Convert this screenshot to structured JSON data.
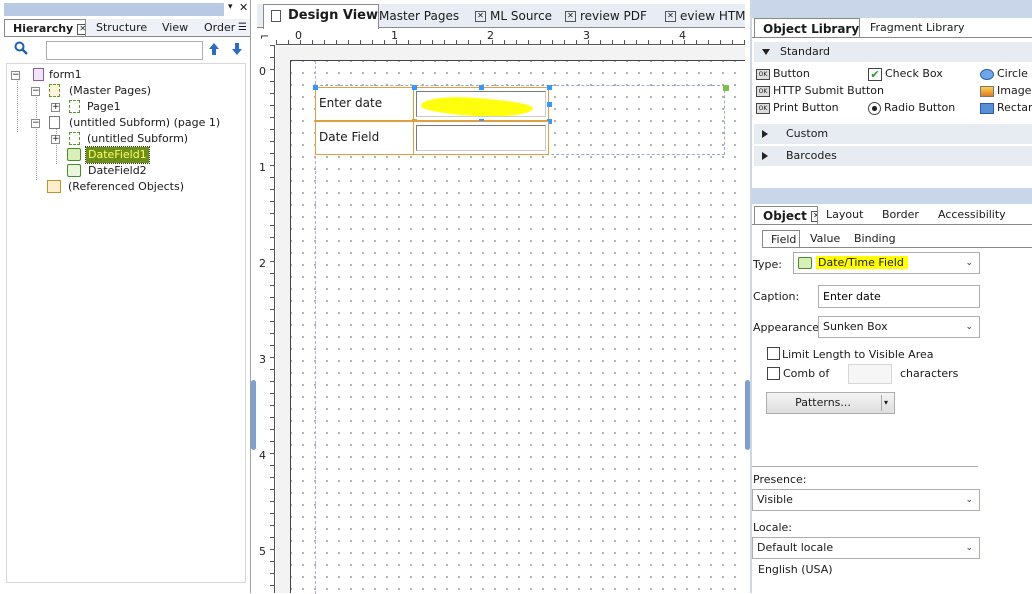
{
  "hierarchy": {
    "tabs": [
      "Hierarchy",
      "Structure",
      "View",
      "Order"
    ],
    "tree": [
      {
        "label": "form1"
      },
      {
        "label": "(Master Pages)"
      },
      {
        "label": "Page1"
      },
      {
        "label": "(untitled Subform) (page 1)"
      },
      {
        "label": "(untitled Subform)"
      },
      {
        "label": "DateField1"
      },
      {
        "label": "DateField2"
      },
      {
        "label": "(Referenced Objects)"
      }
    ]
  },
  "center": {
    "tabs": [
      "Design View",
      "Master Pages",
      "ML Source",
      "review PDF",
      "eview HTM"
    ],
    "ruler_h": [
      "0",
      "1",
      "2",
      "3",
      "4"
    ],
    "ruler_v": [
      "0",
      "1",
      "2",
      "3",
      "4",
      "5"
    ],
    "fields": [
      {
        "caption": "Enter date"
      },
      {
        "caption": "Date Field"
      }
    ]
  },
  "library": {
    "tabs": [
      "Object Library",
      "Fragment Library"
    ],
    "sections": [
      "Standard",
      "Custom",
      "Barcodes"
    ],
    "items": [
      "Button",
      "Check Box",
      "Circle",
      "HTTP Submit Button",
      "Image",
      "Print Button",
      "Radio Button",
      "Rectan"
    ]
  },
  "props": {
    "tabs": [
      "Object",
      "Layout",
      "Border",
      "Accessibility"
    ],
    "subtabs": [
      "Field",
      "Value",
      "Binding"
    ],
    "type_label": "Type:",
    "type_value": "Date/Time Field",
    "caption_label": "Caption:",
    "caption_value": "Enter date",
    "appearance_label": "Appearance:",
    "appearance_value": "Sunken Box",
    "limit_length": "Limit Length to Visible Area",
    "comb_of": "Comb of",
    "characters": "characters",
    "patterns": "Patterns...",
    "presence_label": "Presence:",
    "presence_value": "Visible",
    "locale_label": "Locale:",
    "locale_value": "Default locale",
    "locale_note": "English (USA)"
  },
  "colors": {
    "highlight": "#ffff00",
    "tab_strip": "#dce6f4",
    "selection": "#3399ff"
  }
}
